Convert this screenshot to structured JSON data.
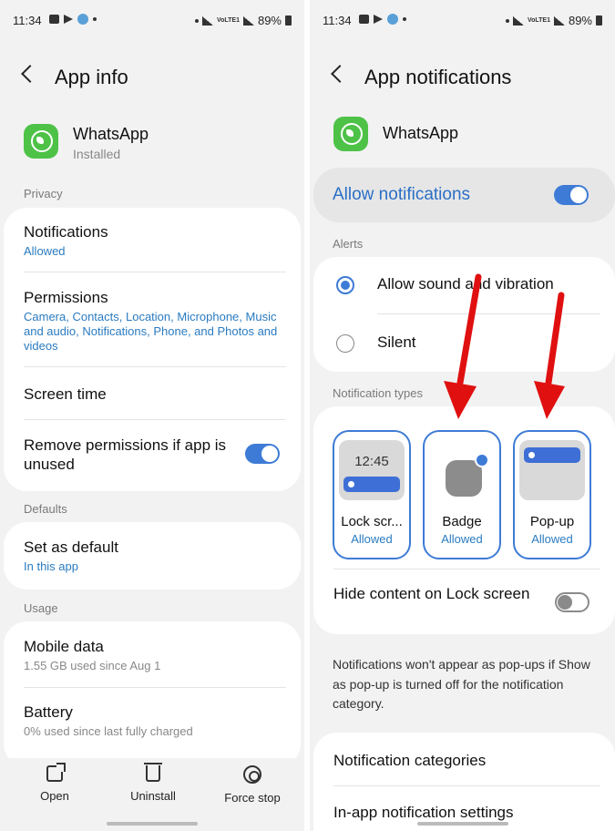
{
  "status_bar": {
    "time": "11:34",
    "battery": "89%",
    "network_label": "VoLTE1"
  },
  "left": {
    "header": {
      "title": "App info"
    },
    "app": {
      "name": "WhatsApp",
      "status": "Installed"
    },
    "sections": {
      "privacy": "Privacy",
      "defaults": "Defaults",
      "usage": "Usage"
    },
    "privacy_items": [
      {
        "title": "Notifications",
        "subtitle": "Allowed"
      },
      {
        "title": "Permissions",
        "subtitle": "Camera, Contacts, Location, Microphone, Music and audio, Notifications, Phone, and Photos and videos"
      },
      {
        "title": "Screen time"
      },
      {
        "title": "Remove permissions if app is unused",
        "toggle": true
      }
    ],
    "defaults_items": [
      {
        "title": "Set as default",
        "subtitle": "In this app"
      }
    ],
    "usage_items": [
      {
        "title": "Mobile data",
        "subtitle": "1.55 GB used since Aug 1"
      },
      {
        "title": "Battery",
        "subtitle": "0% used since last fully charged"
      }
    ],
    "bottom_bar": {
      "open": "Open",
      "uninstall": "Uninstall",
      "force_stop": "Force stop"
    }
  },
  "right": {
    "header": {
      "title": "App notifications"
    },
    "app": {
      "name": "WhatsApp"
    },
    "allow_notifications": {
      "label": "Allow notifications",
      "enabled": true
    },
    "alerts_label": "Alerts",
    "alerts": [
      {
        "label": "Allow sound and vibration",
        "selected": true
      },
      {
        "label": "Silent",
        "selected": false
      }
    ],
    "notification_types_label": "Notification types",
    "notification_types": [
      {
        "name": "Lock scr...",
        "status": "Allowed",
        "preview_time": "12:45"
      },
      {
        "name": "Badge",
        "status": "Allowed"
      },
      {
        "name": "Pop-up",
        "status": "Allowed"
      }
    ],
    "hide_content": {
      "label": "Hide content on Lock screen",
      "enabled": false
    },
    "note": "Notifications won't appear as pop-ups if Show as pop-up is turned off for the notification category.",
    "list_items": [
      {
        "title": "Notification categories"
      },
      {
        "title": "In-app notification settings"
      }
    ]
  },
  "colors": {
    "accent": "#3e7bd6",
    "link": "#2a7bc0",
    "whatsapp": "#4dc247",
    "annotation_arrow": "#e01010",
    "background": "#f2f2f2"
  }
}
